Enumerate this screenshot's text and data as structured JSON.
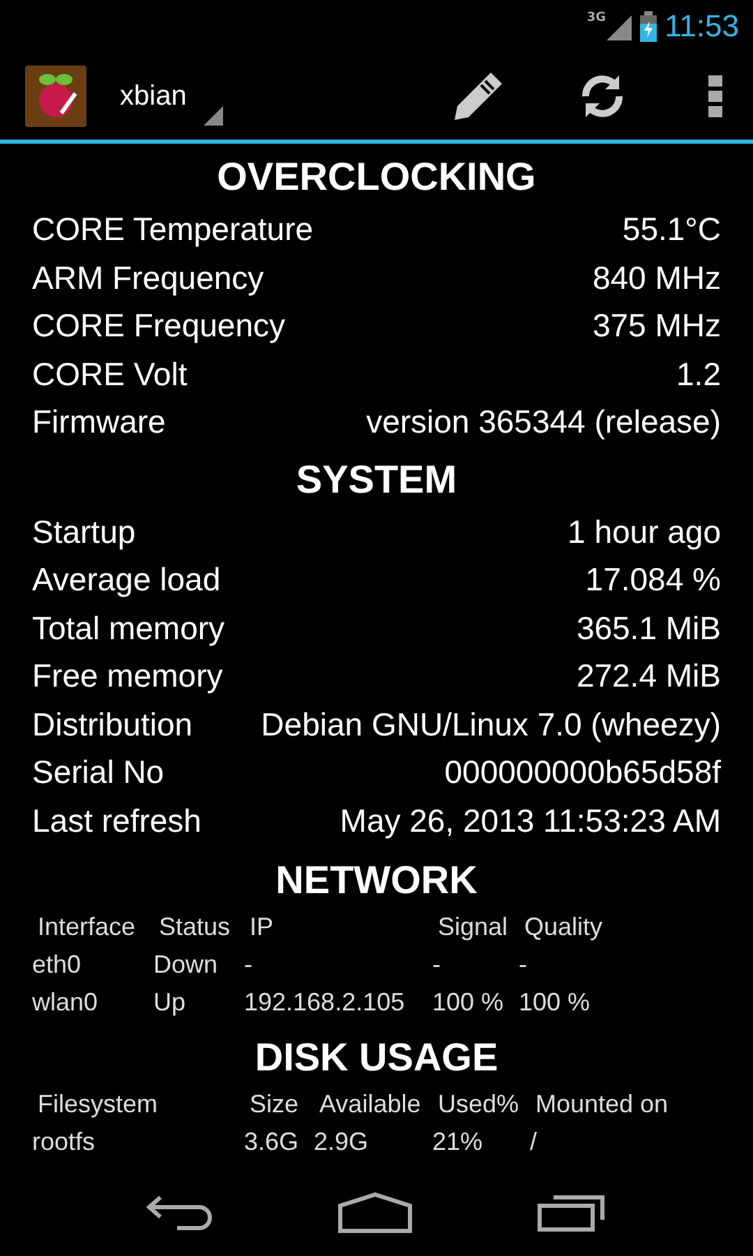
{
  "status_bar": {
    "network_type": "3G",
    "time": "11:53"
  },
  "action_bar": {
    "title": "xbian"
  },
  "sections": [
    {
      "kind": "pairs",
      "title": "OVERCLOCKING",
      "rows": [
        {
          "label": "CORE Temperature",
          "value": "55.1°C"
        },
        {
          "label": "ARM Frequency",
          "value": "840 MHz"
        },
        {
          "label": "CORE Frequency",
          "value": "375 MHz"
        },
        {
          "label": "CORE Volt",
          "value": "1.2"
        },
        {
          "label": "Firmware",
          "value": "version 365344 (release)"
        }
      ]
    },
    {
      "kind": "pairs",
      "title": "SYSTEM",
      "rows": [
        {
          "label": "Startup",
          "value": "1 hour ago"
        },
        {
          "label": "Average load",
          "value": "17.084 %"
        },
        {
          "label": "Total memory",
          "value": "365.1 MiB"
        },
        {
          "label": "Free memory",
          "value": "272.4 MiB"
        },
        {
          "label": "Distribution",
          "value": "Debian GNU/Linux 7.0 (wheezy)"
        },
        {
          "label": "Serial No",
          "value": "000000000b65d58f"
        },
        {
          "label": "Last refresh",
          "value": "May 26, 2013 11:53:23 AM"
        }
      ]
    },
    {
      "kind": "table",
      "title": "NETWORK",
      "columns": [
        "Interface",
        "Status",
        "IP",
        "Signal",
        "Quality"
      ],
      "rows": [
        [
          "eth0",
          "Down",
          "-",
          "-",
          "-"
        ],
        [
          "wlan0",
          "Up",
          "192.168.2.105",
          "100 %",
          "100 %"
        ]
      ]
    },
    {
      "kind": "table",
      "title": "DISK USAGE",
      "columns": [
        "Filesystem",
        "Size",
        "Available",
        "Used%",
        "Mounted on"
      ],
      "rows": [
        [
          "rootfs",
          "3.6G",
          "2.9G",
          "21%",
          "/"
        ]
      ]
    }
  ]
}
